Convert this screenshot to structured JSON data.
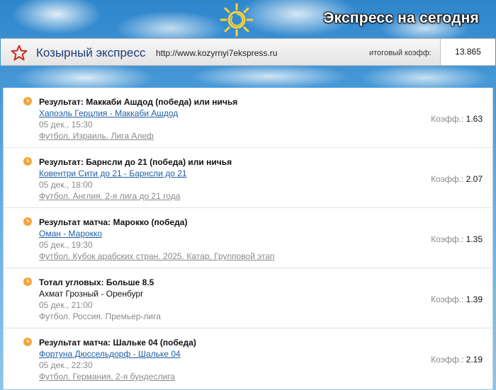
{
  "banner": {
    "title": "Экспресс на сегодня"
  },
  "header": {
    "brand": "Козырный экспресс",
    "url": "http://www.kozyrnyi7ekspress.ru",
    "total_label": "итоговый коэфф:",
    "total_value": "13.865"
  },
  "colors": {
    "accent_star": "#d0281f",
    "clock": "#f3a53b",
    "link": "#1e5ea6"
  },
  "odds_label": "Коэфф.:",
  "bets": [
    {
      "title": "Результат: Маккаби Ашдод (победа) или ничья",
      "match": "Хапоэль Герцлия - Маккаби Ашдод",
      "match_link": true,
      "date": "05 дек., 15:30",
      "league": "Футбол. Израиль. Лига Алеф",
      "league_link": true,
      "odds": "1.63"
    },
    {
      "title": "Результат: Барнсли до 21 (победа) или ничья",
      "match": "Ковентри Сити до 21 - Барнсли до 21",
      "match_link": true,
      "date": "05 дек., 18:00",
      "league": "Футбол. Англия. 2-я лига до 21 года",
      "league_link": true,
      "odds": "2.07"
    },
    {
      "title": "Результат матча: Марокко (победа)",
      "match": "Оман - Марокко",
      "match_link": true,
      "date": "05 дек., 19:30",
      "league": "Футбол. Кубок арабских стран. 2025. Катар. Групповой этап",
      "league_link": true,
      "odds": "1.35"
    },
    {
      "title": "Тотал угловых: Больше 8.5",
      "match": "Ахмат Грозный - Оренбург",
      "match_link": false,
      "date": "05 дек., 21:00",
      "league": "Футбол. Россия. Премьер-лига",
      "league_link": false,
      "odds": "1.39"
    },
    {
      "title": "Результат матча: Шальке 04 (победа)",
      "match": "Фортуна Дюссельдорф - Шальке 04",
      "match_link": true,
      "date": "05 дек., 22:30",
      "league": "Футбол. Германия. 2-я бундеслига",
      "league_link": true,
      "odds": "2.19"
    }
  ]
}
